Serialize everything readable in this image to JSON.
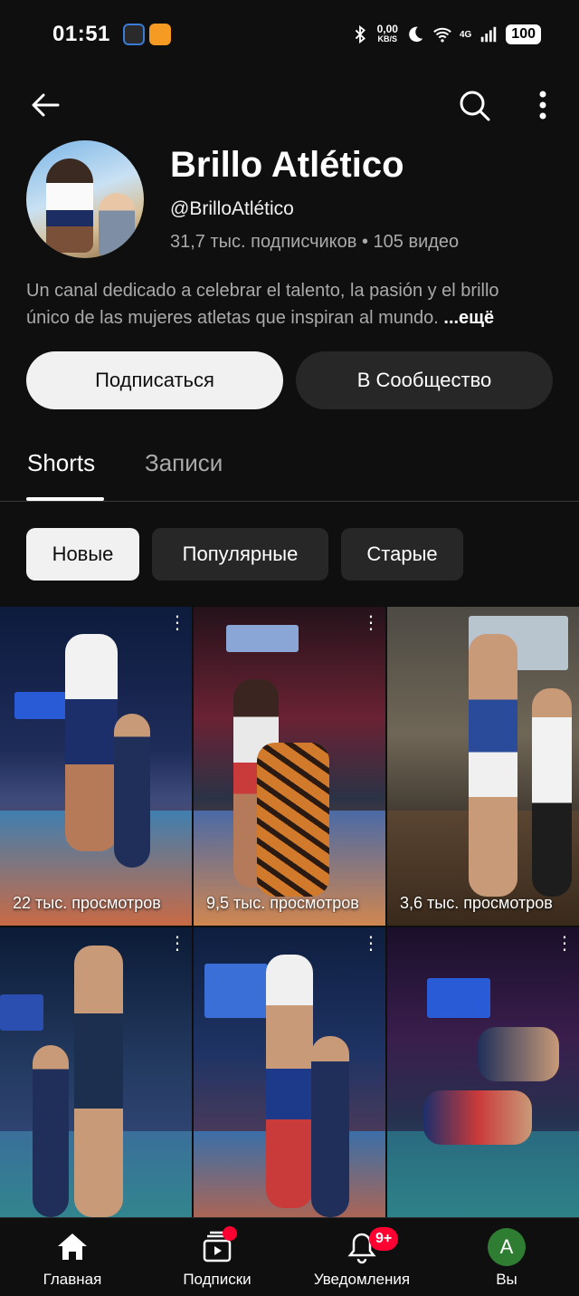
{
  "status_bar": {
    "time": "01:51",
    "net_speed_value": "0,00",
    "net_speed_unit": "KB/S",
    "network": "4G",
    "battery": "100"
  },
  "app_bar": {
    "back_icon": "arrow-left-icon",
    "search_icon": "search-icon",
    "more_icon": "more-vertical-icon"
  },
  "channel": {
    "name": "Brillo Atlético",
    "handle": "@BrilloAtlético",
    "stats": "31,7 тыс. подписчиков • 105 видео",
    "description": "Un canal dedicado a celebrar el talento, la pasión y el brillo único de las mujeres atletas que inspiran al mundo.",
    "more_label": "...ещё"
  },
  "buttons": {
    "subscribe": "Подписаться",
    "community": "В Сообщество"
  },
  "tabs": [
    {
      "label": "Shorts",
      "active": true
    },
    {
      "label": "Записи",
      "active": false
    }
  ],
  "filters": [
    {
      "label": "Новые",
      "selected": true
    },
    {
      "label": "Популярные",
      "selected": false
    },
    {
      "label": "Старые",
      "selected": false
    }
  ],
  "shorts": [
    {
      "views": "22 тыс. просмотров"
    },
    {
      "views": "9,5 тыс. просмотров"
    },
    {
      "views": "3,6 тыс. просмотров"
    },
    {
      "views": ""
    },
    {
      "views": ""
    },
    {
      "views": ""
    }
  ],
  "bottom_nav": [
    {
      "label": "Главная",
      "icon": "home-icon"
    },
    {
      "label": "Подписки",
      "icon": "subscriptions-icon"
    },
    {
      "label": "Уведомления",
      "icon": "bell-icon",
      "badge": "9+"
    },
    {
      "label": "Вы",
      "icon": "avatar",
      "avatar_letter": "A"
    }
  ],
  "colors": {
    "background": "#0f0f0f",
    "badge": "#ff0033",
    "avatar": "#2e7d32"
  }
}
